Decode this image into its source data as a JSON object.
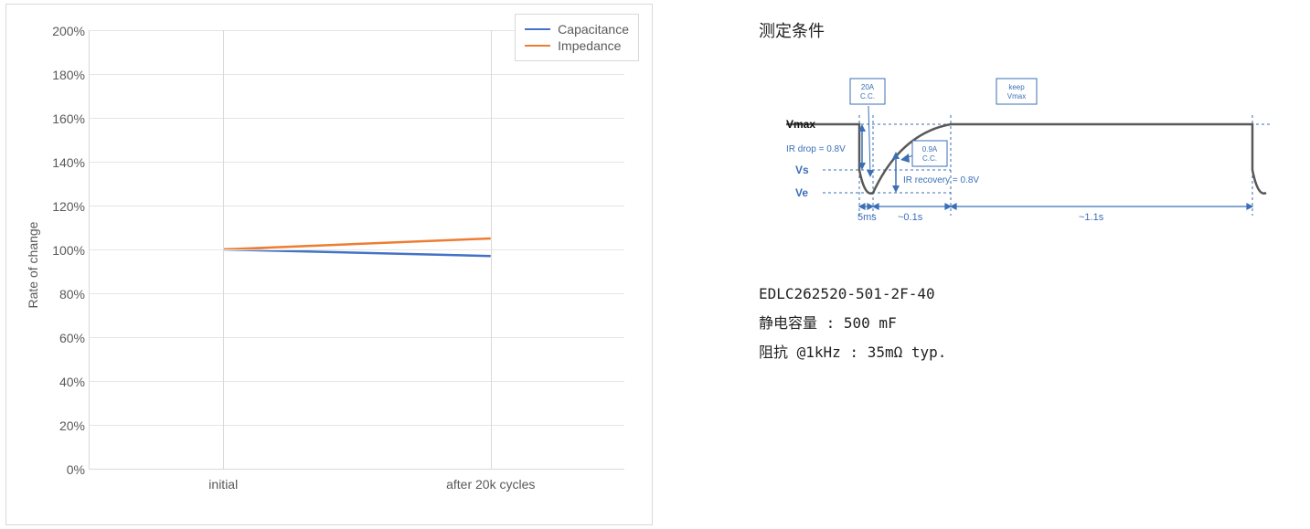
{
  "chart_data": {
    "type": "line",
    "categories": [
      "initial",
      "after 20k cycles"
    ],
    "series": [
      {
        "name": "Capacitance",
        "values": [
          100,
          97
        ],
        "color": "#4472c4"
      },
      {
        "name": "Impedance",
        "values": [
          100,
          105
        ],
        "color": "#ed7d31"
      }
    ],
    "ylabel": "Rate of change",
    "ylim": [
      0,
      200
    ],
    "ytick_step": 20,
    "ytick_format": "percent"
  },
  "right": {
    "title": "测定条件",
    "diagram": {
      "vmax_label": "Vmax",
      "vs_label": "Vs",
      "ve_label": "Ve",
      "ir_drop": "IR drop = 0.8V",
      "ir_recovery": "IR recovery = 0.8V",
      "box1": "20A\nC.C.",
      "box2": "0.9A\nC.C.",
      "box3": "keep\nVmax",
      "t1": "5ms",
      "t2": "~0.1s",
      "t3": "~1.1s"
    },
    "info": {
      "part": "EDLC262520-501-2F-40",
      "cap": "静电容量 : 500 mF",
      "imp": "阻抗 @1kHz : 35mΩ typ."
    }
  }
}
